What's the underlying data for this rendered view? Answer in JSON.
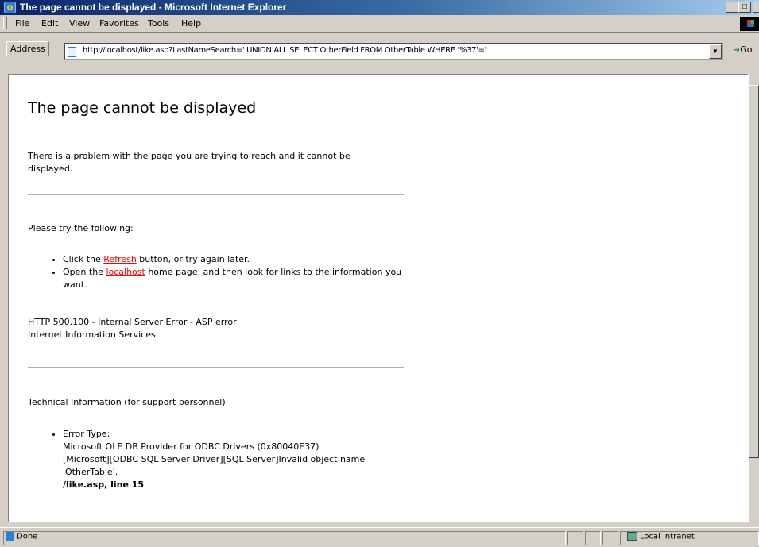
{
  "window": {
    "title": "The page cannot be displayed - Microsoft Internet Explorer",
    "minimize_glyph": "_",
    "maximize_glyph": "□",
    "close_glyph": "×"
  },
  "menu": {
    "items": [
      "File",
      "Edit",
      "View",
      "Favorites",
      "Tools",
      "Help"
    ]
  },
  "address": {
    "label": "Address",
    "url": "http://localhost/like.asp?LastNameSearch=' UNION ALL SELECT OtherField FROM OtherTable WHERE '%37'='",
    "go_label": "Go"
  },
  "page": {
    "heading": "The page cannot be displayed",
    "intro": "There is a problem with the page you are trying to reach and it cannot be displayed.",
    "try_heading": "Please try the following:",
    "bullet1_pre": "Click the ",
    "bullet1_link": "Refresh",
    "bullet1_post": " button, or try again later.",
    "bullet2_pre": "Open the ",
    "bullet2_link": "localhost",
    "bullet2_post": " home page, and then look for links to the information you want.",
    "error_line1": "HTTP 500.100 - Internal Server Error - ASP error",
    "error_line2": "Internet Information Services",
    "tech_heading": "Technical Information (for support personnel)",
    "error_type_label": "Error Type:",
    "error_provider": "Microsoft OLE DB Provider for ODBC Drivers (0x80040E37)",
    "error_message": "[Microsoft][ODBC SQL Server Driver][SQL Server]Invalid object name 'OtherTable'.",
    "error_location": "/like.asp, line 15"
  },
  "status": {
    "text": "Done",
    "zone": "Local intranet"
  },
  "colors": {
    "link": "#ff0000",
    "titlebar_start": "#0a246a",
    "chrome": "#d4d0c8"
  }
}
